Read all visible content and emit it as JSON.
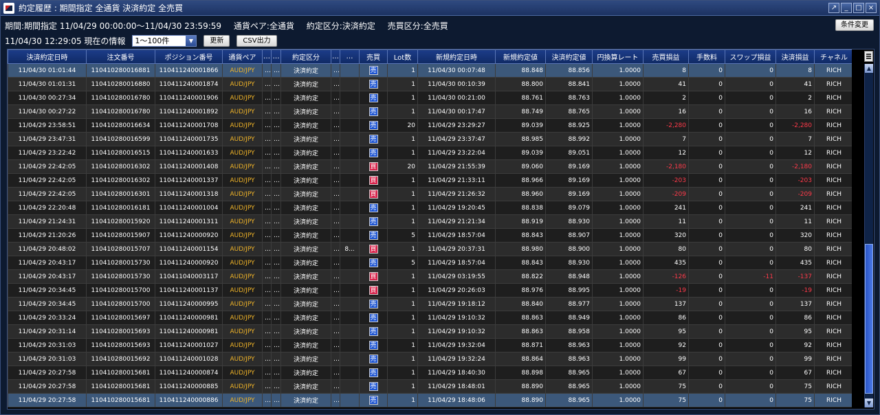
{
  "window": {
    "title": "約定履歴 : 期間指定 全通貨 決済約定 全売買",
    "buttons": [
      "↗",
      "_",
      "□",
      "×"
    ]
  },
  "filter_info": {
    "period": "期間:期間指定  11/04/29 00:00:00～11/04/30 23:59:59",
    "currency_pair": "通貨ペア:全通貨",
    "execution_type": "約定区分:決済約定",
    "trade_side": "売買区分:全売買",
    "change_button": "条件変更"
  },
  "toolbar": {
    "timestamp": "11/04/30 12:29:05 現在の情報",
    "range_select": "1～100件",
    "refresh_button": "更新",
    "csv_button": "CSV出力"
  },
  "columns": [
    "決済約定日時",
    "注文番号",
    "ポジション番号",
    "通貨ペア",
    "…",
    "…",
    "約定区分",
    "…",
    "…",
    "売買",
    "Lot数",
    "新規約定日時",
    "新規約定値",
    "決済約定値",
    "円換算レート",
    "売買損益",
    "手数料",
    "スワップ損益",
    "決済損益",
    "チャネル"
  ],
  "rows": [
    {
      "dt": "11/04/30 01:01:44",
      "order": "110410280016881",
      "pos": "110411240001866",
      "pair": "AUD/JPY",
      "d1": "…",
      "d2": "…",
      "type": "決済約定",
      "d3": "…",
      "d4": "",
      "side": "売",
      "lot": "1",
      "open_dt": "11/04/30 00:07:48",
      "open_px": "88.848",
      "close_px": "88.856",
      "rate": "1.0000",
      "pl": "8",
      "fee": "0",
      "swap": "0",
      "net": "8",
      "channel": "RICH",
      "neg": false,
      "neg_swap": false
    },
    {
      "dt": "11/04/30 01:01:31",
      "order": "110410280016880",
      "pos": "110411240001874",
      "pair": "AUD/JPY",
      "d1": "…",
      "d2": "…",
      "type": "決済約定",
      "d3": "…",
      "d4": "",
      "side": "売",
      "lot": "1",
      "open_dt": "11/04/30 00:10:39",
      "open_px": "88.800",
      "close_px": "88.841",
      "rate": "1.0000",
      "pl": "41",
      "fee": "0",
      "swap": "0",
      "net": "41",
      "channel": "RICH",
      "neg": false,
      "neg_swap": false
    },
    {
      "dt": "11/04/30 00:27:34",
      "order": "110410280016780",
      "pos": "110411240001906",
      "pair": "AUD/JPY",
      "d1": "…",
      "d2": "…",
      "type": "決済約定",
      "d3": "…",
      "d4": "",
      "side": "売",
      "lot": "1",
      "open_dt": "11/04/30 00:21:00",
      "open_px": "88.761",
      "close_px": "88.763",
      "rate": "1.0000",
      "pl": "2",
      "fee": "0",
      "swap": "0",
      "net": "2",
      "channel": "RICH",
      "neg": false,
      "neg_swap": false
    },
    {
      "dt": "11/04/30 00:27:22",
      "order": "110410280016780",
      "pos": "110411240001892",
      "pair": "AUD/JPY",
      "d1": "…",
      "d2": "…",
      "type": "決済約定",
      "d3": "…",
      "d4": "",
      "side": "売",
      "lot": "1",
      "open_dt": "11/04/30 00:17:47",
      "open_px": "88.749",
      "close_px": "88.765",
      "rate": "1.0000",
      "pl": "16",
      "fee": "0",
      "swap": "0",
      "net": "16",
      "channel": "RICH",
      "neg": false,
      "neg_swap": false
    },
    {
      "dt": "11/04/29 23:58:51",
      "order": "110410280016634",
      "pos": "110411240001708",
      "pair": "AUD/JPY",
      "d1": "…",
      "d2": "…",
      "type": "決済約定",
      "d3": "…",
      "d4": "",
      "side": "売",
      "lot": "20",
      "open_dt": "11/04/29 23:29:27",
      "open_px": "89.039",
      "close_px": "88.925",
      "rate": "1.0000",
      "pl": "-2,280",
      "fee": "0",
      "swap": "0",
      "net": "-2,280",
      "channel": "RICH",
      "neg": true,
      "neg_swap": false
    },
    {
      "dt": "11/04/29 23:47:31",
      "order": "110410280016599",
      "pos": "110411240001735",
      "pair": "AUD/JPY",
      "d1": "…",
      "d2": "…",
      "type": "決済約定",
      "d3": "…",
      "d4": "",
      "side": "売",
      "lot": "1",
      "open_dt": "11/04/29 23:37:47",
      "open_px": "88.985",
      "close_px": "88.992",
      "rate": "1.0000",
      "pl": "7",
      "fee": "0",
      "swap": "0",
      "net": "7",
      "channel": "RICH",
      "neg": false,
      "neg_swap": false
    },
    {
      "dt": "11/04/29 23:22:42",
      "order": "110410280016515",
      "pos": "110411240001633",
      "pair": "AUD/JPY",
      "d1": "…",
      "d2": "…",
      "type": "決済約定",
      "d3": "…",
      "d4": "",
      "side": "売",
      "lot": "1",
      "open_dt": "11/04/29 23:22:04",
      "open_px": "89.039",
      "close_px": "89.051",
      "rate": "1.0000",
      "pl": "12",
      "fee": "0",
      "swap": "0",
      "net": "12",
      "channel": "RICH",
      "neg": false,
      "neg_swap": false
    },
    {
      "dt": "11/04/29 22:42:05",
      "order": "110410280016302",
      "pos": "110411240001408",
      "pair": "AUD/JPY",
      "d1": "…",
      "d2": "…",
      "type": "決済約定",
      "d3": "…",
      "d4": "",
      "side": "買",
      "lot": "20",
      "open_dt": "11/04/29 21:55:39",
      "open_px": "89.060",
      "close_px": "89.169",
      "rate": "1.0000",
      "pl": "-2,180",
      "fee": "0",
      "swap": "0",
      "net": "-2,180",
      "channel": "RICH",
      "neg": true,
      "neg_swap": false
    },
    {
      "dt": "11/04/29 22:42:05",
      "order": "110410280016302",
      "pos": "110411240001337",
      "pair": "AUD/JPY",
      "d1": "…",
      "d2": "…",
      "type": "決済約定",
      "d3": "…",
      "d4": "",
      "side": "買",
      "lot": "1",
      "open_dt": "11/04/29 21:33:11",
      "open_px": "88.966",
      "close_px": "89.169",
      "rate": "1.0000",
      "pl": "-203",
      "fee": "0",
      "swap": "0",
      "net": "-203",
      "channel": "RICH",
      "neg": true,
      "neg_swap": false
    },
    {
      "dt": "11/04/29 22:42:05",
      "order": "110410280016301",
      "pos": "110411240001318",
      "pair": "AUD/JPY",
      "d1": "…",
      "d2": "…",
      "type": "決済約定",
      "d3": "…",
      "d4": "",
      "side": "買",
      "lot": "1",
      "open_dt": "11/04/29 21:26:32",
      "open_px": "88.960",
      "close_px": "89.169",
      "rate": "1.0000",
      "pl": "-209",
      "fee": "0",
      "swap": "0",
      "net": "-209",
      "channel": "RICH",
      "neg": true,
      "neg_swap": false
    },
    {
      "dt": "11/04/29 22:20:48",
      "order": "110410280016181",
      "pos": "110411240001004",
      "pair": "AUD/JPY",
      "d1": "…",
      "d2": "…",
      "type": "決済約定",
      "d3": "…",
      "d4": "",
      "side": "売",
      "lot": "1",
      "open_dt": "11/04/29 19:20:45",
      "open_px": "88.838",
      "close_px": "89.079",
      "rate": "1.0000",
      "pl": "241",
      "fee": "0",
      "swap": "0",
      "net": "241",
      "channel": "RICH",
      "neg": false,
      "neg_swap": false
    },
    {
      "dt": "11/04/29 21:24:31",
      "order": "110410280015920",
      "pos": "110411240001311",
      "pair": "AUD/JPY",
      "d1": "…",
      "d2": "…",
      "type": "決済約定",
      "d3": "…",
      "d4": "",
      "side": "売",
      "lot": "1",
      "open_dt": "11/04/29 21:21:34",
      "open_px": "88.919",
      "close_px": "88.930",
      "rate": "1.0000",
      "pl": "11",
      "fee": "0",
      "swap": "0",
      "net": "11",
      "channel": "RICH",
      "neg": false,
      "neg_swap": false
    },
    {
      "dt": "11/04/29 21:20:26",
      "order": "110410280015907",
      "pos": "110411240000920",
      "pair": "AUD/JPY",
      "d1": "…",
      "d2": "…",
      "type": "決済約定",
      "d3": "…",
      "d4": "",
      "side": "売",
      "lot": "5",
      "open_dt": "11/04/29 18:57:04",
      "open_px": "88.843",
      "close_px": "88.907",
      "rate": "1.0000",
      "pl": "320",
      "fee": "0",
      "swap": "0",
      "net": "320",
      "channel": "RICH",
      "neg": false,
      "neg_swap": false
    },
    {
      "dt": "11/04/29 20:48:02",
      "order": "110410280015707",
      "pos": "110411240001154",
      "pair": "AUD/JPY",
      "d1": "…",
      "d2": "…",
      "type": "決済約定",
      "d3": "…",
      "d4": "8...",
      "side": "買",
      "lot": "1",
      "open_dt": "11/04/29 20:37:31",
      "open_px": "88.980",
      "close_px": "88.900",
      "rate": "1.0000",
      "pl": "80",
      "fee": "0",
      "swap": "0",
      "net": "80",
      "channel": "RICH",
      "neg": false,
      "neg_swap": false
    },
    {
      "dt": "11/04/29 20:43:17",
      "order": "110410280015730",
      "pos": "110411240000920",
      "pair": "AUD/JPY",
      "d1": "…",
      "d2": "…",
      "type": "決済約定",
      "d3": "…",
      "d4": "",
      "side": "売",
      "lot": "5",
      "open_dt": "11/04/29 18:57:04",
      "open_px": "88.843",
      "close_px": "88.930",
      "rate": "1.0000",
      "pl": "435",
      "fee": "0",
      "swap": "0",
      "net": "435",
      "channel": "RICH",
      "neg": false,
      "neg_swap": false
    },
    {
      "dt": "11/04/29 20:43:17",
      "order": "110410280015730",
      "pos": "110411040003117",
      "pair": "AUD/JPY",
      "d1": "…",
      "d2": "…",
      "type": "決済約定",
      "d3": "…",
      "d4": "",
      "side": "買",
      "lot": "1",
      "open_dt": "11/04/29 03:19:55",
      "open_px": "88.822",
      "close_px": "88.948",
      "rate": "1.0000",
      "pl": "-126",
      "fee": "0",
      "swap": "-11",
      "net": "-137",
      "channel": "RICH",
      "neg": true,
      "neg_swap": true
    },
    {
      "dt": "11/04/29 20:34:45",
      "order": "110410280015700",
      "pos": "110411240001137",
      "pair": "AUD/JPY",
      "d1": "…",
      "d2": "…",
      "type": "決済約定",
      "d3": "…",
      "d4": "",
      "side": "買",
      "lot": "1",
      "open_dt": "11/04/29 20:26:03",
      "open_px": "88.976",
      "close_px": "88.995",
      "rate": "1.0000",
      "pl": "-19",
      "fee": "0",
      "swap": "0",
      "net": "-19",
      "channel": "RICH",
      "neg": true,
      "neg_swap": false
    },
    {
      "dt": "11/04/29 20:34:45",
      "order": "110410280015700",
      "pos": "110411240000995",
      "pair": "AUD/JPY",
      "d1": "…",
      "d2": "…",
      "type": "決済約定",
      "d3": "…",
      "d4": "",
      "side": "売",
      "lot": "1",
      "open_dt": "11/04/29 19:18:12",
      "open_px": "88.840",
      "close_px": "88.977",
      "rate": "1.0000",
      "pl": "137",
      "fee": "0",
      "swap": "0",
      "net": "137",
      "channel": "RICH",
      "neg": false,
      "neg_swap": false
    },
    {
      "dt": "11/04/29 20:33:24",
      "order": "110410280015697",
      "pos": "110411240000981",
      "pair": "AUD/JPY",
      "d1": "…",
      "d2": "…",
      "type": "決済約定",
      "d3": "…",
      "d4": "",
      "side": "売",
      "lot": "1",
      "open_dt": "11/04/29 19:10:32",
      "open_px": "88.863",
      "close_px": "88.949",
      "rate": "1.0000",
      "pl": "86",
      "fee": "0",
      "swap": "0",
      "net": "86",
      "channel": "RICH",
      "neg": false,
      "neg_swap": false
    },
    {
      "dt": "11/04/29 20:31:14",
      "order": "110410280015693",
      "pos": "110411240000981",
      "pair": "AUD/JPY",
      "d1": "…",
      "d2": "…",
      "type": "決済約定",
      "d3": "…",
      "d4": "",
      "side": "売",
      "lot": "1",
      "open_dt": "11/04/29 19:10:32",
      "open_px": "88.863",
      "close_px": "88.958",
      "rate": "1.0000",
      "pl": "95",
      "fee": "0",
      "swap": "0",
      "net": "95",
      "channel": "RICH",
      "neg": false,
      "neg_swap": false
    },
    {
      "dt": "11/04/29 20:31:03",
      "order": "110410280015693",
      "pos": "110411240001027",
      "pair": "AUD/JPY",
      "d1": "…",
      "d2": "…",
      "type": "決済約定",
      "d3": "…",
      "d4": "",
      "side": "売",
      "lot": "1",
      "open_dt": "11/04/29 19:32:04",
      "open_px": "88.871",
      "close_px": "88.963",
      "rate": "1.0000",
      "pl": "92",
      "fee": "0",
      "swap": "0",
      "net": "92",
      "channel": "RICH",
      "neg": false,
      "neg_swap": false
    },
    {
      "dt": "11/04/29 20:31:03",
      "order": "110410280015692",
      "pos": "110411240001028",
      "pair": "AUD/JPY",
      "d1": "…",
      "d2": "…",
      "type": "決済約定",
      "d3": "…",
      "d4": "",
      "side": "売",
      "lot": "1",
      "open_dt": "11/04/29 19:32:24",
      "open_px": "88.864",
      "close_px": "88.963",
      "rate": "1.0000",
      "pl": "99",
      "fee": "0",
      "swap": "0",
      "net": "99",
      "channel": "RICH",
      "neg": false,
      "neg_swap": false
    },
    {
      "dt": "11/04/29 20:27:58",
      "order": "110410280015681",
      "pos": "110411240000874",
      "pair": "AUD/JPY",
      "d1": "…",
      "d2": "…",
      "type": "決済約定",
      "d3": "…",
      "d4": "",
      "side": "売",
      "lot": "1",
      "open_dt": "11/04/29 18:40:30",
      "open_px": "88.898",
      "close_px": "88.965",
      "rate": "1.0000",
      "pl": "67",
      "fee": "0",
      "swap": "0",
      "net": "67",
      "channel": "RICH",
      "neg": false,
      "neg_swap": false
    },
    {
      "dt": "11/04/29 20:27:58",
      "order": "110410280015681",
      "pos": "110411240000885",
      "pair": "AUD/JPY",
      "d1": "…",
      "d2": "…",
      "type": "決済約定",
      "d3": "…",
      "d4": "",
      "side": "売",
      "lot": "1",
      "open_dt": "11/04/29 18:48:01",
      "open_px": "88.890",
      "close_px": "88.965",
      "rate": "1.0000",
      "pl": "75",
      "fee": "0",
      "swap": "0",
      "net": "75",
      "channel": "RICH",
      "neg": false,
      "neg_swap": false
    },
    {
      "dt": "11/04/29 20:27:58",
      "order": "110410280015681",
      "pos": "110411240000886",
      "pair": "AUD/JPY",
      "d1": "…",
      "d2": "…",
      "type": "決済約定",
      "d3": "…",
      "d4": "",
      "side": "売",
      "lot": "1",
      "open_dt": "11/04/29 18:48:06",
      "open_px": "88.890",
      "close_px": "88.965",
      "rate": "1.0000",
      "pl": "75",
      "fee": "0",
      "swap": "0",
      "net": "75",
      "channel": "RICH",
      "neg": false,
      "neg_swap": false
    }
  ],
  "selected_rows": [
    0,
    24
  ],
  "colors": {
    "sell_badge": "#1e55d2",
    "buy_badge": "#d8224a",
    "pair_text": "#f0b428",
    "negative_text": "#ff3a4a",
    "header_bg": "#1b3b88",
    "selected_row_bg": "#3c587a"
  },
  "icons": {
    "title_icon": "app-logo-icon",
    "column_chooser": "columns-icon",
    "scroll_up": "arrow-up-icon",
    "scroll_down": "arrow-down-icon"
  },
  "scrollbar": {
    "arrow_up": "▲",
    "arrow_down": "▼"
  }
}
